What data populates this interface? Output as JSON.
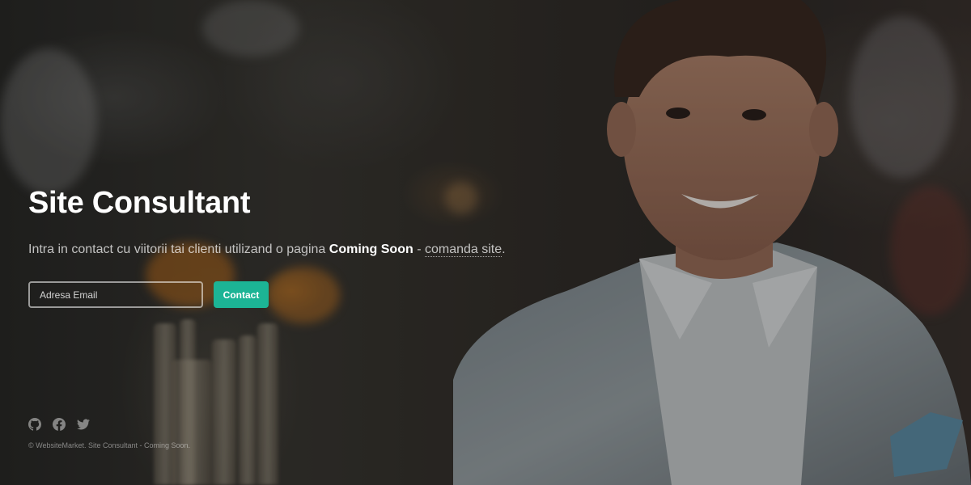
{
  "hero": {
    "title": "Site Consultant",
    "subtitle_prefix": "Intra in contact cu viitorii tai clienti utilizand o pagina",
    "subtitle_strong": "Coming Soon",
    "subtitle_separator": "-",
    "subtitle_link": "comanda site",
    "subtitle_suffix": "."
  },
  "form": {
    "email_placeholder": "Adresa Email",
    "email_value": "",
    "submit_label": "Contact"
  },
  "social": {
    "icons": [
      "github-icon",
      "facebook-icon",
      "twitter-icon"
    ]
  },
  "footer": {
    "copyright": "© WebsiteMarket. Site Consultant - Coming Soon."
  },
  "colors": {
    "accent": "#1cb495",
    "text": "#ffffff"
  }
}
